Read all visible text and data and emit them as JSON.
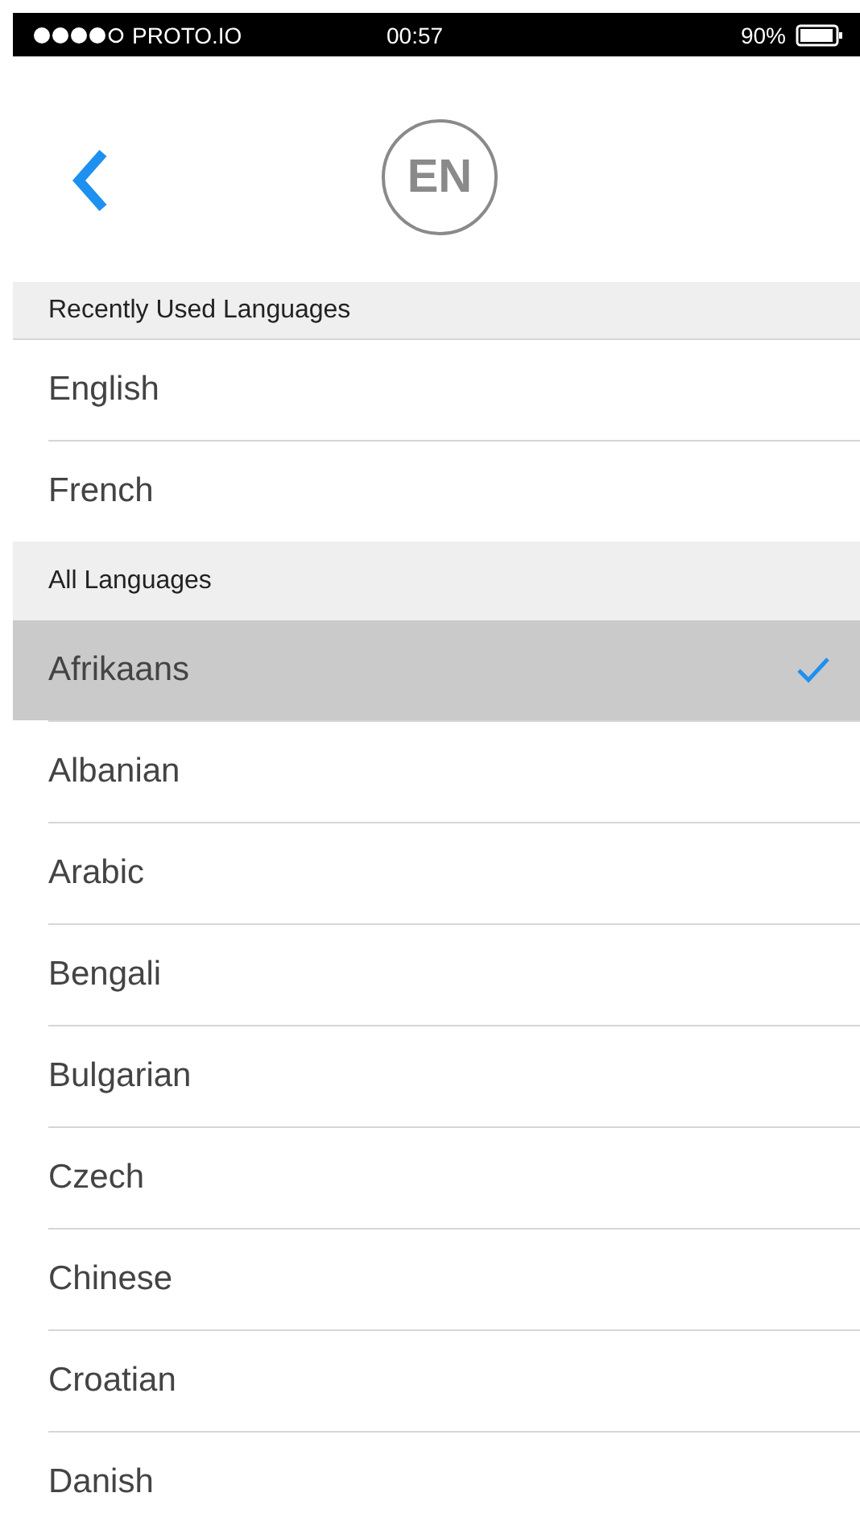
{
  "status_bar": {
    "carrier": "PROTO.IO",
    "time": "00:57",
    "battery": "90%"
  },
  "header": {
    "badge": "EN"
  },
  "sections": [
    {
      "title": "Recently Used Languages",
      "items": [
        {
          "label": "English",
          "selected": false
        },
        {
          "label": "French",
          "selected": false
        }
      ]
    },
    {
      "title": "All Languages",
      "items": [
        {
          "label": "Afrikaans",
          "selected": true
        },
        {
          "label": "Albanian",
          "selected": false
        },
        {
          "label": "Arabic",
          "selected": false
        },
        {
          "label": "Bengali",
          "selected": false
        },
        {
          "label": "Bulgarian",
          "selected": false
        },
        {
          "label": "Czech",
          "selected": false
        },
        {
          "label": "Chinese",
          "selected": false
        },
        {
          "label": "Croatian",
          "selected": false
        },
        {
          "label": "Danish",
          "selected": false
        }
      ]
    }
  ]
}
